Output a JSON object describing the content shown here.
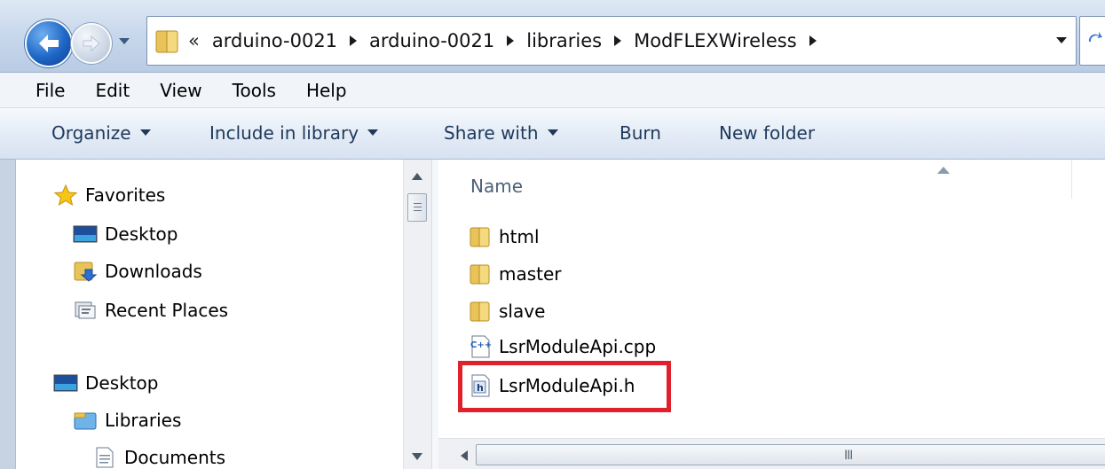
{
  "window": {
    "breadcrumb_overflow": "«",
    "breadcrumbs": [
      "arduino-0021",
      "arduino-0021",
      "libraries",
      "ModFLEXWireless"
    ]
  },
  "menubar": {
    "items": [
      "File",
      "Edit",
      "View",
      "Tools",
      "Help"
    ]
  },
  "commandbar": {
    "organize": "Organize",
    "include_in_library": "Include in library",
    "share_with": "Share with",
    "burn": "Burn",
    "new_folder": "New folder"
  },
  "navpane": {
    "favorites": "Favorites",
    "desktop_fav": "Desktop",
    "downloads": "Downloads",
    "recent_places": "Recent Places",
    "desktop": "Desktop",
    "libraries": "Libraries",
    "documents": "Documents"
  },
  "content": {
    "column_name": "Name",
    "files": [
      {
        "name": "html",
        "type": "folder"
      },
      {
        "name": "master",
        "type": "folder"
      },
      {
        "name": "slave",
        "type": "folder"
      },
      {
        "name": "LsrModuleApi.cpp",
        "type": "cpp"
      },
      {
        "name": "LsrModuleApi.h",
        "type": "header"
      }
    ],
    "cpp_icon_text": "C++",
    "header_icon_text": "h"
  },
  "scrollbar": {
    "h_grip": "III"
  },
  "colors": {
    "highlight": "#e0202a",
    "command_text": "#1e395b",
    "header_text": "#4c607a"
  }
}
